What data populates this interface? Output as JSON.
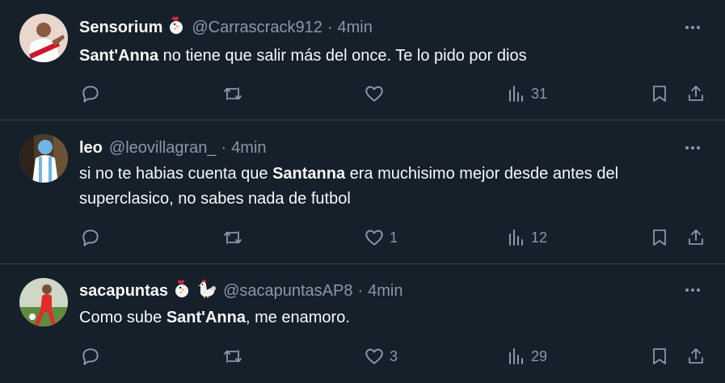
{
  "tweets": [
    {
      "name": "Sensorium",
      "emojis": [
        "chicken-icon"
      ],
      "handle": "@Carrascrack912",
      "dot": "·",
      "time": "4min",
      "text_bold": "Sant'Anna",
      "text_rest": " no tiene que salir más del once. Te lo pido por dios",
      "reply_count": "",
      "retweet_count": "",
      "like_count": "",
      "views_count": "31"
    },
    {
      "name": "leo",
      "emojis": [],
      "handle": "@leovillagran_",
      "dot": "·",
      "time": "4min",
      "text_pre": "si no te habias cuenta que ",
      "text_bold": "Santanna",
      "text_rest": " era muchisimo mejor desde antes del superclasico, no sabes nada de futbol",
      "reply_count": "",
      "retweet_count": "",
      "like_count": "1",
      "views_count": "12"
    },
    {
      "name": "sacapuntas",
      "emojis": [
        "chicken-icon",
        "rooster-icon"
      ],
      "handle": "@sacapuntasAP8",
      "dot": "·",
      "time": "4min",
      "text_pre": "Como sube ",
      "text_bold": "Sant'Anna",
      "text_rest": ", me enamoro.",
      "reply_count": "",
      "retweet_count": "",
      "like_count": "3",
      "views_count": "29"
    }
  ],
  "colors": {
    "background": "#15202b",
    "divider": "#38444d",
    "text_primary": "#f7f9f9",
    "text_secondary": "#8b98a5"
  }
}
